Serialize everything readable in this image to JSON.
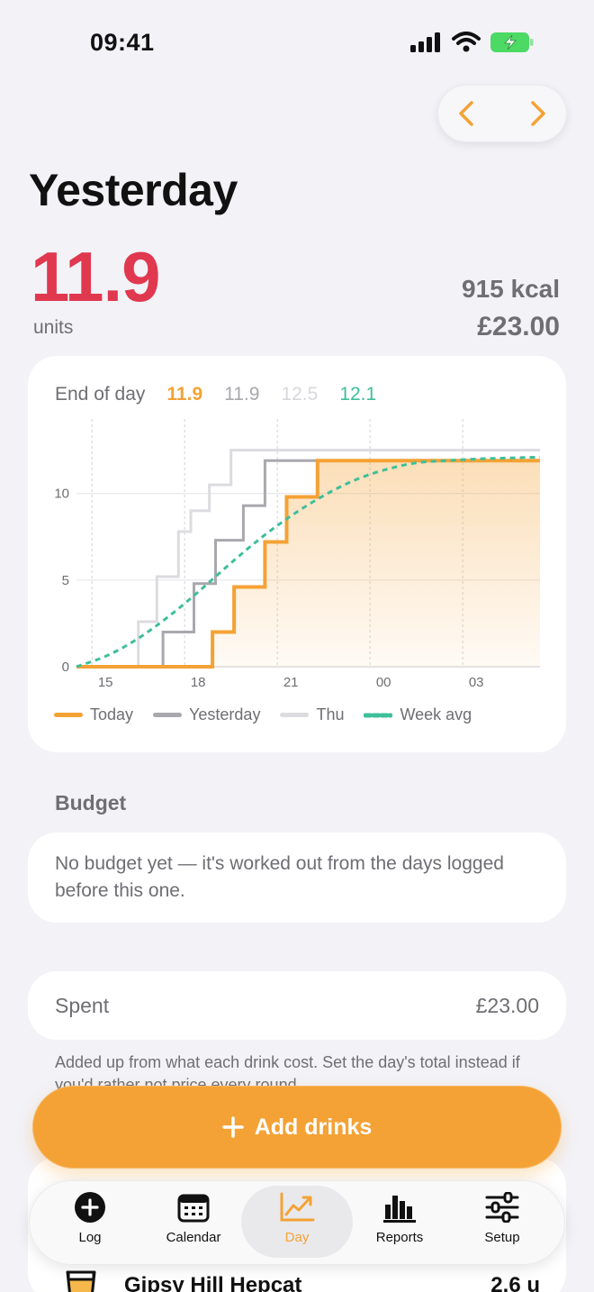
{
  "status": {
    "time": "09:41"
  },
  "page": {
    "title": "Yesterday"
  },
  "summary": {
    "units_value": "11.9",
    "units_label": "units",
    "kcal": "915 kcal",
    "money": "£23.00"
  },
  "end_of_day": {
    "label": "End of day",
    "today": "11.9",
    "yesterday": "11.9",
    "thu": "12.5",
    "week_avg": "12.1"
  },
  "legend": {
    "today": "Today",
    "yesterday": "Yesterday",
    "thu": "Thu",
    "week_avg": "Week avg"
  },
  "colors": {
    "accent": "#f4a235",
    "units": "#e0384f",
    "week": "#3dbf9a",
    "yesterday": "#a8a8ad",
    "thu": "#dcdce0"
  },
  "chart_data": {
    "type": "line",
    "x_ticks": [
      "15",
      "18",
      "21",
      "00",
      "03"
    ],
    "y_ticks": [
      "0",
      "5",
      "10"
    ],
    "ylim": [
      0,
      13
    ],
    "xlim_hours": [
      14.5,
      29.5
    ],
    "series": [
      {
        "name": "Today",
        "step": true,
        "x": [
          14.5,
          18.9,
          18.9,
          19.6,
          19.6,
          20.6,
          20.6,
          21.3,
          21.3,
          22.3,
          22.3,
          29.5
        ],
        "y": [
          0,
          0,
          2.0,
          2.0,
          4.6,
          4.6,
          7.2,
          7.2,
          9.8,
          9.8,
          11.9,
          11.9
        ]
      },
      {
        "name": "Yesterday",
        "step": true,
        "x": [
          14.5,
          17.3,
          17.3,
          18.3,
          18.3,
          19.0,
          19.0,
          19.9,
          19.9,
          20.6,
          20.6,
          21.4,
          21.4,
          29.5
        ],
        "y": [
          0,
          0,
          2.0,
          2.0,
          4.8,
          4.8,
          7.3,
          7.3,
          9.3,
          9.3,
          11.9,
          11.9,
          11.9,
          11.9
        ]
      },
      {
        "name": "Thu",
        "step": true,
        "x": [
          14.5,
          16.5,
          16.5,
          17.1,
          17.1,
          17.8,
          17.8,
          18.2,
          18.2,
          18.8,
          18.8,
          19.5,
          19.5,
          20.0,
          20.0,
          29.5
        ],
        "y": [
          0,
          0,
          2.6,
          2.6,
          5.2,
          5.2,
          7.8,
          7.8,
          9.0,
          9.0,
          10.5,
          10.5,
          12.5,
          12.5,
          12.5,
          12.5
        ]
      },
      {
        "name": "Week avg",
        "dashed": true,
        "x": [
          14.5,
          15.5,
          16.5,
          17.5,
          18.5,
          19.5,
          20.5,
          21.5,
          22.5,
          23.5,
          24.5,
          25.5,
          26.5,
          27.5,
          28.5,
          29.5
        ],
        "y": [
          0,
          0.6,
          1.6,
          2.9,
          4.4,
          6.0,
          7.5,
          8.8,
          9.9,
          10.8,
          11.4,
          11.8,
          11.9,
          12.0,
          12.05,
          12.1
        ]
      }
    ]
  },
  "budget": {
    "title": "Budget",
    "text": "No budget yet — it's worked out from the days logged before this one."
  },
  "spent": {
    "label": "Spent",
    "value": "£23.00",
    "hint": "Added up from what each drink cost. Set the day's total instead if you'd rather not price every round."
  },
  "add_button": {
    "label": "Add drinks"
  },
  "drink": {
    "name": "Gipsy Hill Hepcat",
    "units": "2.6 u"
  },
  "tabs": [
    {
      "label": "Log",
      "icon": "plus-circle-icon"
    },
    {
      "label": "Calendar",
      "icon": "calendar-icon"
    },
    {
      "label": "Day",
      "icon": "trend-chart-icon"
    },
    {
      "label": "Reports",
      "icon": "bar-chart-icon"
    },
    {
      "label": "Setup",
      "icon": "sliders-icon"
    }
  ]
}
